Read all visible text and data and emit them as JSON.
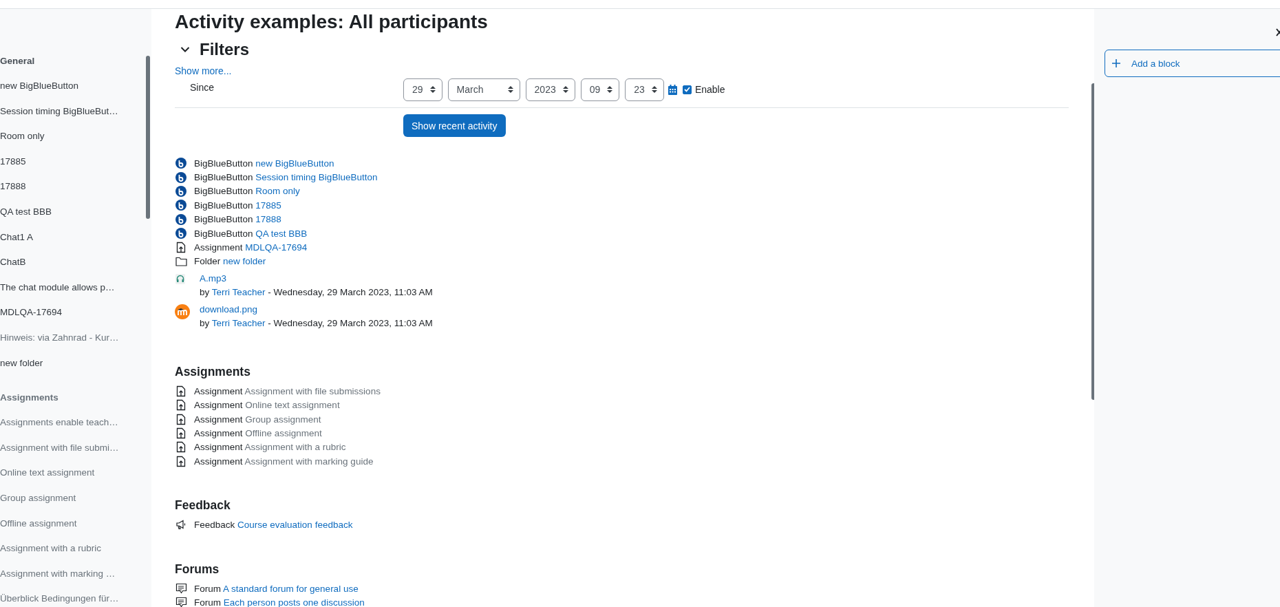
{
  "sidebar": {
    "sections": [
      {
        "title": "General",
        "dimmed": false,
        "items": [
          {
            "label": "new BigBlueButton",
            "dimmed": false
          },
          {
            "label": "Session timing BigBlueBut…",
            "dimmed": false
          },
          {
            "label": "Room only",
            "dimmed": false
          },
          {
            "label": "17885",
            "dimmed": false
          },
          {
            "label": "17888",
            "dimmed": false
          },
          {
            "label": "QA test BBB",
            "dimmed": false
          },
          {
            "label": "Chat1 A",
            "dimmed": false
          },
          {
            "label": "ChatB",
            "dimmed": false
          },
          {
            "label": "The chat module allows p…",
            "dimmed": false
          },
          {
            "label": "MDLQA-17694",
            "dimmed": false
          },
          {
            "label": "Hinweis: via Zahnrad - Kur…",
            "dimmed": true
          },
          {
            "label": "new folder",
            "dimmed": false
          }
        ]
      },
      {
        "title": "Assignments",
        "dimmed": true,
        "items": [
          {
            "label": "Assignments enable teach…",
            "dimmed": true
          },
          {
            "label": "Assignment with file submi…",
            "dimmed": true
          },
          {
            "label": "Online text assignment",
            "dimmed": true
          },
          {
            "label": "Group assignment",
            "dimmed": true
          },
          {
            "label": "Offline assignment",
            "dimmed": true
          },
          {
            "label": "Assignment with a rubric",
            "dimmed": true
          },
          {
            "label": "Assignment with marking …",
            "dimmed": true
          },
          {
            "label": "Überblick Bedingungen für…",
            "dimmed": true
          }
        ]
      }
    ]
  },
  "page": {
    "title": "Activity examples: All participants",
    "filters": {
      "heading": "Filters",
      "expanded": true,
      "show_more": "Show more...",
      "since_label": "Since",
      "date_fields": [
        {
          "value": "29"
        },
        {
          "value": "March"
        },
        {
          "value": "2023"
        },
        {
          "value": "09"
        },
        {
          "value": "23"
        }
      ],
      "enable": {
        "label": "Enable",
        "checked": true
      },
      "submit": "Show recent activity"
    },
    "recent": [
      {
        "kind": "bigbluebutton",
        "module": "BigBlueButton",
        "name": "new BigBlueButton"
      },
      {
        "kind": "bigbluebutton",
        "module": "BigBlueButton",
        "name": "Session timing BigBlueButton"
      },
      {
        "kind": "bigbluebutton",
        "module": "BigBlueButton",
        "name": "Room only"
      },
      {
        "kind": "bigbluebutton",
        "module": "BigBlueButton",
        "name": "17885"
      },
      {
        "kind": "bigbluebutton",
        "module": "BigBlueButton",
        "name": "17888"
      },
      {
        "kind": "bigbluebutton",
        "module": "BigBlueButton",
        "name": "QA test BBB"
      },
      {
        "kind": "assignment",
        "module": "Assignment",
        "name": "MDLQA-17694"
      },
      {
        "kind": "folder",
        "module": "Folder",
        "name": "new folder"
      },
      {
        "kind": "audio",
        "name": "A.mp3",
        "by": "by",
        "author": "Terri Teacher",
        "date": "- Wednesday, 29 March 2023, 11:03 AM"
      },
      {
        "kind": "image",
        "name": "download.png",
        "by": "by",
        "author": "Terri Teacher",
        "date": "- Wednesday, 29 March 2023, 11:03 AM"
      }
    ],
    "sections": [
      {
        "heading": "Assignments",
        "items": [
          {
            "kind": "assignment",
            "module": "Assignment",
            "name": "Assignment with file submissions",
            "dimmed": true
          },
          {
            "kind": "assignment",
            "module": "Assignment",
            "name": "Online text assignment",
            "dimmed": true
          },
          {
            "kind": "assignment",
            "module": "Assignment",
            "name": "Group assignment",
            "dimmed": true
          },
          {
            "kind": "assignment",
            "module": "Assignment",
            "name": "Offline assignment",
            "dimmed": true
          },
          {
            "kind": "assignment",
            "module": "Assignment",
            "name": "Assignment with a rubric",
            "dimmed": true
          },
          {
            "kind": "assignment",
            "module": "Assignment",
            "name": "Assignment with marking guide",
            "dimmed": true
          }
        ]
      },
      {
        "heading": "Feedback",
        "items": [
          {
            "kind": "feedback",
            "module": "Feedback",
            "name": "Course evaluation feedback",
            "dimmed": false
          }
        ]
      },
      {
        "heading": "Forums",
        "items": [
          {
            "kind": "forum",
            "module": "Forum",
            "name": "A standard forum for general use",
            "dimmed": false
          },
          {
            "kind": "forum",
            "module": "Forum",
            "name": "Each person posts one discussion",
            "dimmed": false
          }
        ]
      }
    ]
  },
  "block_panel": {
    "add_block": "Add a block"
  }
}
